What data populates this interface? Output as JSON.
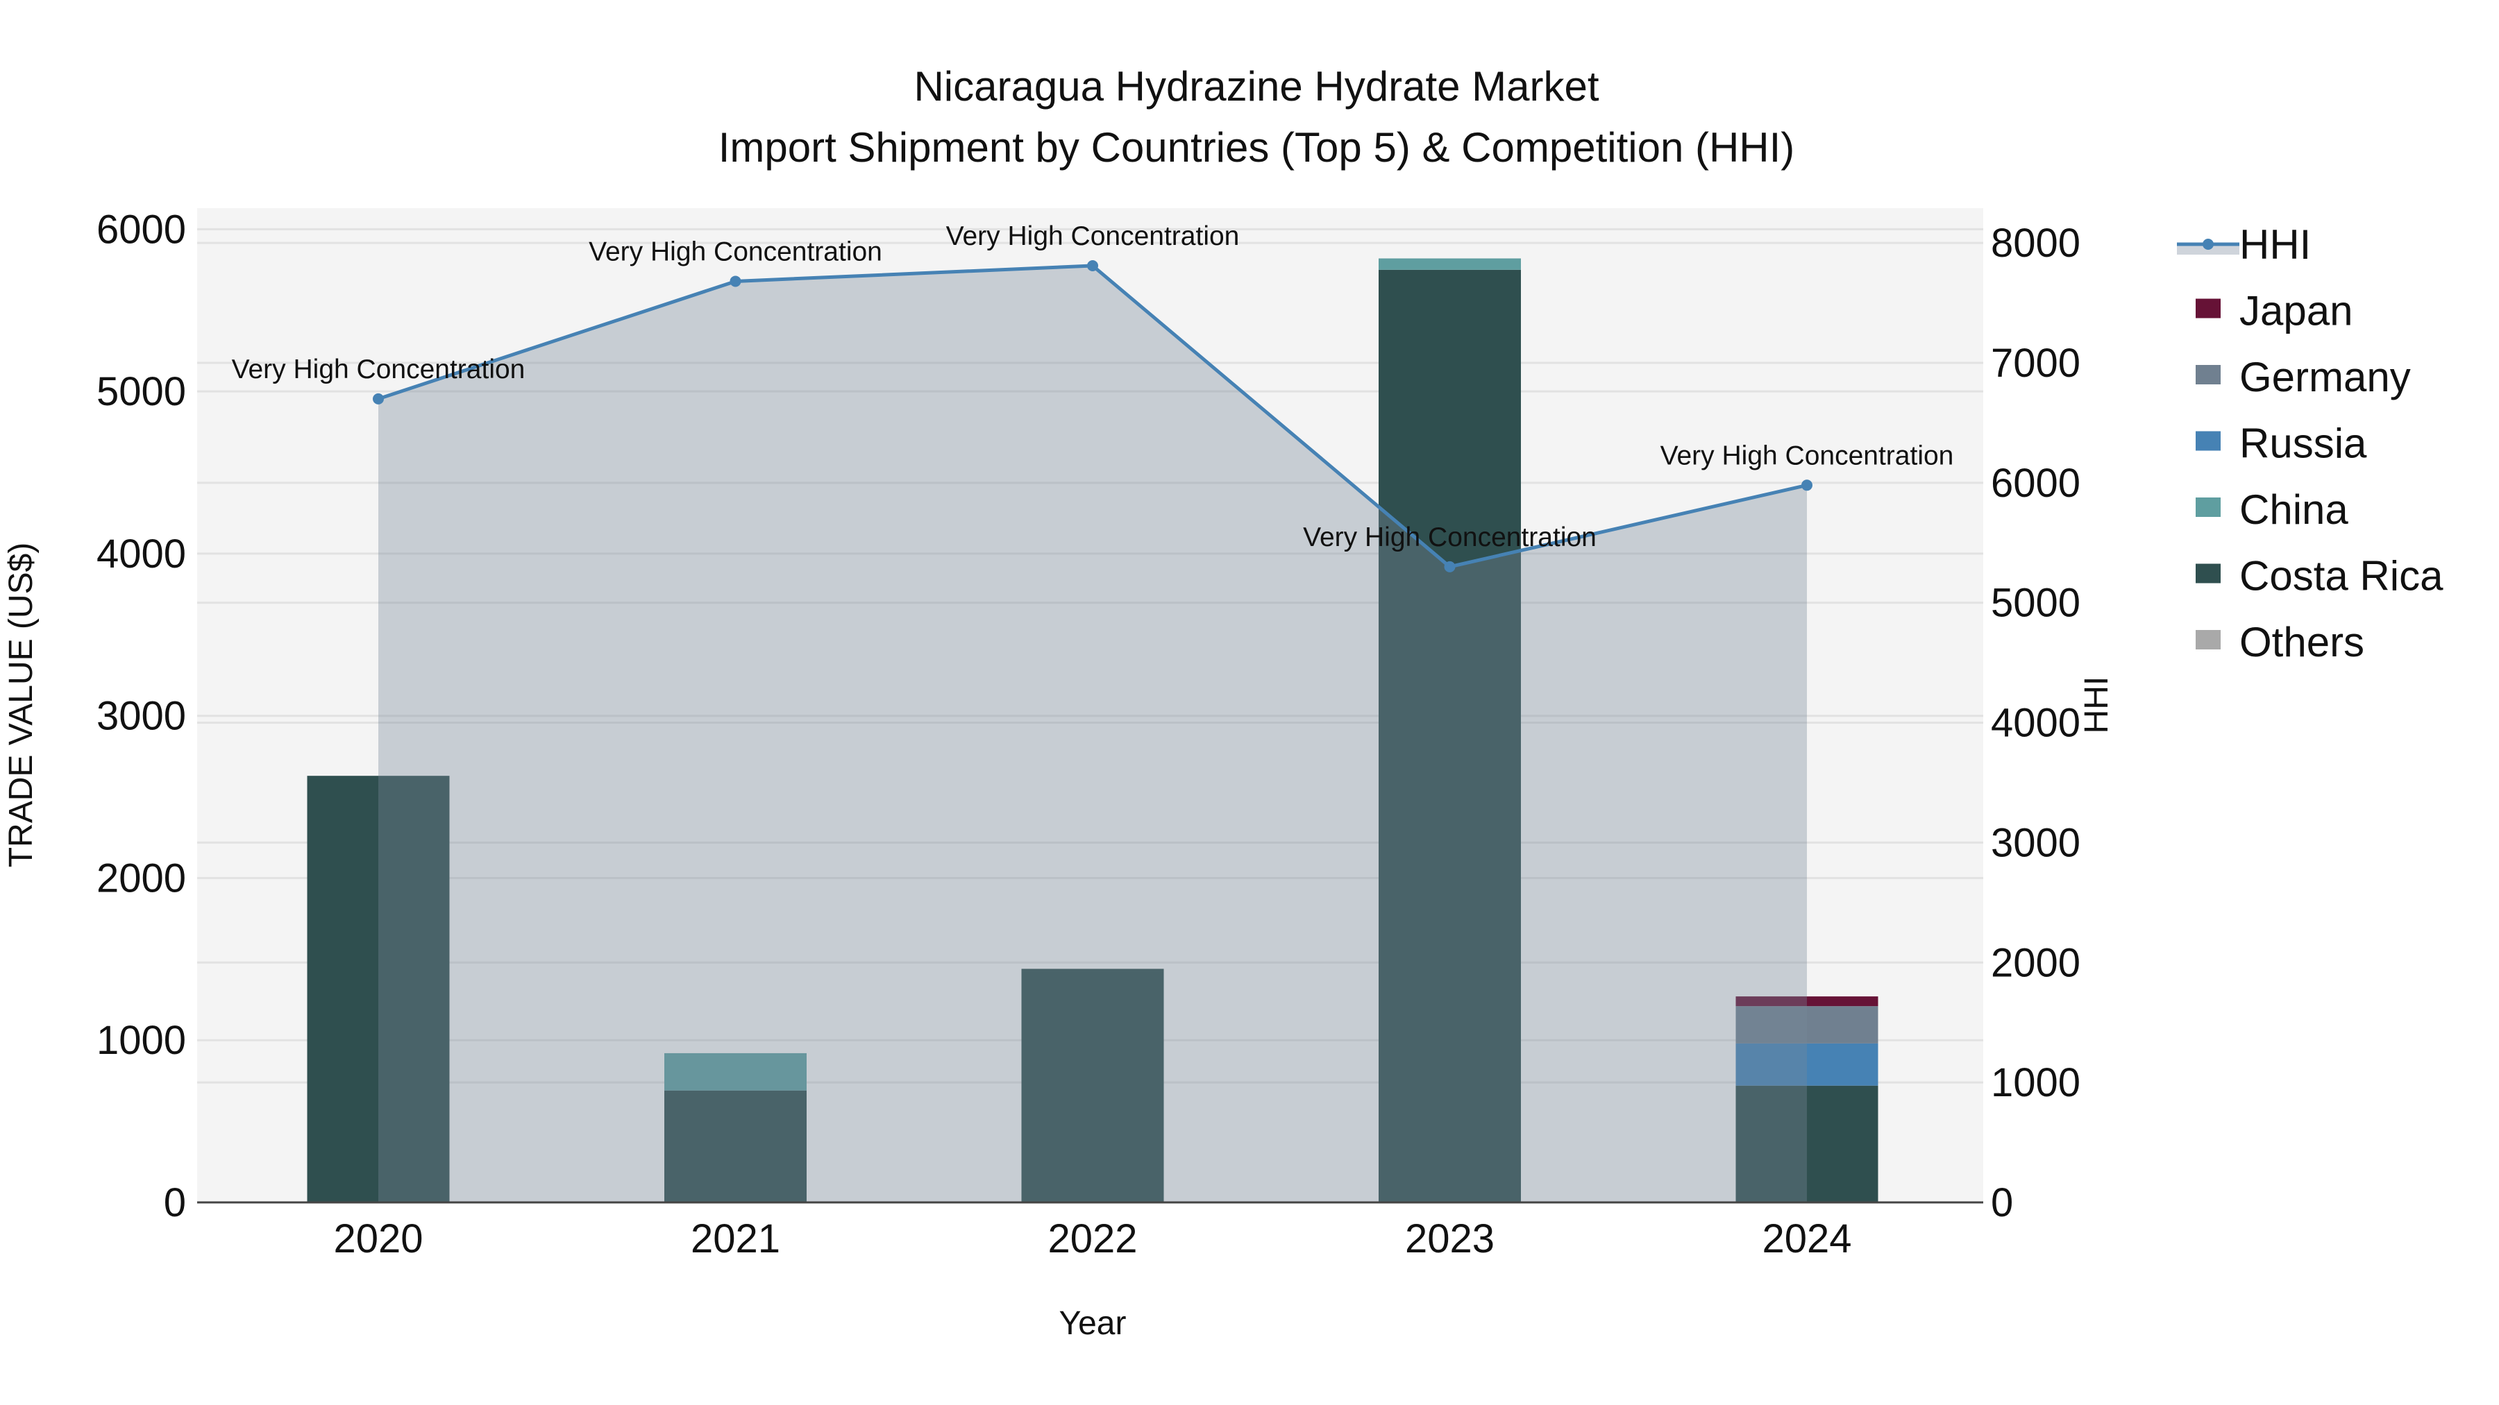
{
  "chart_data": {
    "type": "bar",
    "title": "Nicaragua Hydrazine Hydrate Market",
    "subtitle": "Import Shipment by Countries (Top 5) & Competition (HHI)",
    "xlabel": "Year",
    "ylabel": "TRADE VALUE (US$)",
    "y2label": "HHI",
    "categories": [
      "2020",
      "2021",
      "2022",
      "2023",
      "2024"
    ],
    "ylim": [
      0,
      6130
    ],
    "y2lim": [
      0,
      8290
    ],
    "yticks": [
      0,
      1000,
      2000,
      3000,
      4000,
      5000,
      6000
    ],
    "y2ticks": [
      0,
      1000,
      2000,
      3000,
      4000,
      5000,
      6000,
      7000,
      8000
    ],
    "stacked": true,
    "grid": true,
    "legend_position": "right",
    "series": [
      {
        "name": "Others",
        "color": "#a9a9a9",
        "values": [
          0,
          0,
          0,
          0,
          0
        ]
      },
      {
        "name": "Costa Rica",
        "color": "#2f4f4f",
        "values": [
          2630,
          690,
          1440,
          5750,
          720
        ]
      },
      {
        "name": "China",
        "color": "#5f9ea0",
        "values": [
          0,
          230,
          0,
          70,
          0
        ]
      },
      {
        "name": "Russia",
        "color": "#4682b4",
        "values": [
          0,
          0,
          0,
          0,
          260
        ]
      },
      {
        "name": "Germany",
        "color": "#708090",
        "values": [
          0,
          0,
          0,
          0,
          230
        ]
      },
      {
        "name": "Japan",
        "color": "#661236",
        "values": [
          0,
          0,
          0,
          0,
          60
        ]
      }
    ],
    "hhi": {
      "name": "HHI",
      "color": "#4682b4",
      "values": [
        6700,
        7680,
        7810,
        5300,
        5980
      ],
      "annotations": [
        "Very High Concentration",
        "Very High Concentration",
        "Very High Concentration",
        "Very High Concentration",
        "Very High Concentration"
      ]
    },
    "legend": [
      "HHI",
      "Japan",
      "Germany",
      "Russia",
      "China",
      "Costa Rica",
      "Others"
    ]
  }
}
